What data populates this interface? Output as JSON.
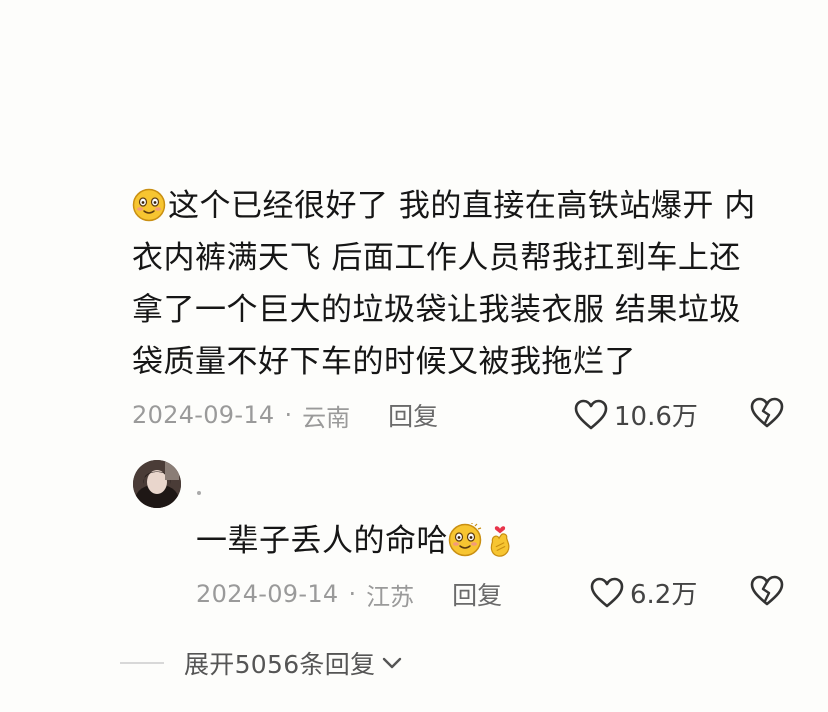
{
  "comment": {
    "emoji": "smiling-face-emoji",
    "text": "这个已经很好了 我的直接在高铁站爆开 内衣内裤满天飞 后面工作人员帮我扛到车上还拿了一个巨大的垃圾袋让我装衣服 结果垃圾袋质量不好下车的时候又被我拖烂了",
    "date": "2024-09-14",
    "separator": "·",
    "location": "云南",
    "reply_label": "回复",
    "likes": "10.6万"
  },
  "reply": {
    "text": "一辈子丢人的命哈",
    "emojis": [
      "smiling-face-emoji",
      "finger-heart-emoji"
    ],
    "date": "2024-09-14",
    "separator": "·",
    "location": "江苏",
    "reply_label": "回复",
    "likes": "6.2万"
  },
  "expand": {
    "label": "展开5056条回复"
  },
  "colors": {
    "text": "#161616",
    "meta": "#9a9a9a",
    "emoji_face": "#f7c531"
  }
}
